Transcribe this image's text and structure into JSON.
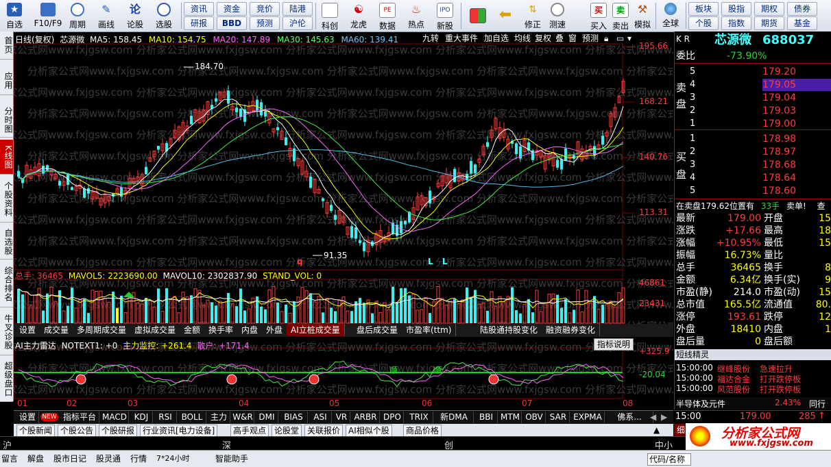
{
  "toolbar": {
    "buttons": [
      {
        "label": "自选",
        "icon": "star-icon"
      },
      {
        "label": "F10/F9",
        "icon": "f10-icon"
      },
      {
        "label": "周期",
        "icon": "clock-icon"
      },
      {
        "label": "画线",
        "icon": "pencil-icon"
      },
      {
        "label": "论股",
        "icon": "discuss-icon"
      },
      {
        "label": "选股",
        "icon": "select-icon"
      }
    ],
    "small_buttons": [
      "资讯",
      "资金",
      "竞价",
      "陆港",
      "研报",
      "BBD",
      "预测",
      "沪伦"
    ],
    "buttons2": [
      {
        "label": "科创",
        "icon": "chart-icon"
      },
      {
        "label": "龙虎",
        "icon": "dragon-icon"
      },
      {
        "label": "数据",
        "icon": "pe-icon"
      },
      {
        "label": "热点",
        "icon": "fire-icon"
      },
      {
        "label": "新股",
        "icon": "ipo-icon"
      }
    ],
    "buttons3": [
      {
        "label": "",
        "icon": "window-icon"
      },
      {
        "label": "",
        "icon": "back-arrow-icon"
      },
      {
        "label": "修正",
        "icon": "updown-icon"
      },
      {
        "label": "测速",
        "icon": "speed-icon"
      },
      {
        "label": "买入",
        "icon": "buy-icon"
      },
      {
        "label": "卖出",
        "icon": "sell-icon"
      },
      {
        "label": "模拟",
        "icon": "hammer-icon"
      },
      {
        "label": "全球",
        "icon": "globe-icon"
      }
    ],
    "right_buttons": [
      "板块",
      "股指",
      "期权",
      "债券",
      "个股",
      "指数",
      "期货",
      "基金"
    ]
  },
  "leftnav": [
    "首页",
    "应用",
    "分时图",
    "K线图",
    "个股资料",
    "自选股",
    "综合排名",
    "牛叉诊股",
    "超级盘口"
  ],
  "chart": {
    "header": {
      "title": "日线(复权)",
      "name": "芯源微",
      "ma5": "MA5: 158.45",
      "ma10": "MA10: 154.75",
      "ma20": "MA20: 147.89",
      "ma30": "MA30: 145.63",
      "ma60": "MA60: 139.41"
    },
    "menu": [
      "九转",
      "重大事件",
      "加自选",
      "均线",
      "复权",
      "叠",
      "窗",
      "预测"
    ],
    "price_axis": [
      "195.66",
      "168.21",
      "140.76",
      "113.31"
    ],
    "high_label": "184.70",
    "low_label": "91.35",
    "markers": [
      "q",
      "L",
      "L"
    ],
    "vol_header": {
      "total": "总手: 36465",
      "mavol5": "MAVOL5: 2223690.00",
      "mavol10": "MAVOL10: 2302837.90",
      "stand": "STAND_VOL: 0"
    },
    "vol_axis": [
      "46861",
      "23431"
    ],
    "tabs": [
      "设置",
      "成交量",
      "多周期成交量",
      "虚拟成交量",
      "金额",
      "换手率",
      "内盘",
      "外盘",
      "AI立桩成交量",
      "盘后成交量",
      "市盈率(ttm)",
      "陆股通持股变化",
      "融资融券变化"
    ],
    "selected_tab": "AI立桩成交量",
    "ind_header": {
      "name": "AI主力雷达",
      "notext": "NOTEXT1: +0",
      "main": "主力监控: +261.4",
      "retail": "散户: +171.4"
    },
    "ind_button": "指标说明",
    "ind_axis": [
      "+325.9",
      "-20.04"
    ],
    "ind_labels": [
      "顺",
      "顺"
    ],
    "months": [
      "01",
      "02",
      "03",
      "04",
      "05",
      "06",
      "07",
      "08"
    ]
  },
  "indicators": [
    "设置",
    "NEW",
    "指标平台",
    "MACD",
    "KDJ",
    "RSI",
    "BOLL",
    "主力",
    "W&R",
    "DMI",
    "BIAS",
    "ASI",
    "VR",
    "ARBR",
    "DPO",
    "TRIX",
    "新DMA",
    "BBI",
    "MTM",
    "OBV",
    "SAR",
    "EXPMA",
    "佛系..."
  ],
  "news_tabs": [
    "个股新闻",
    "个股公告",
    "个股研报",
    "行业资讯[电力设备]",
    "高手观点",
    "论股堂",
    "关联报价",
    "AI相似个股",
    "商品价格"
  ],
  "index_bar": [
    "沪",
    "深",
    "创",
    "中小"
  ],
  "status": [
    "留言",
    "解盘",
    "股市日记",
    "股灵通",
    "行情",
    "7*24小时",
    "智能助手"
  ],
  "status_right": "代码/名称",
  "watermark_url": "www.fxjgsw.com",
  "watermark_cn": "分析家公式网",
  "right": {
    "kr": "K R",
    "stock_name": "芯源微",
    "stock_code": "688037",
    "weibi_label": "委比",
    "weibi": "-73.90%",
    "sell_label": "卖盘",
    "buy_label": "买盘",
    "asks": [
      {
        "n": "5",
        "p": "179.20"
      },
      {
        "n": "4",
        "p": "179.05"
      },
      {
        "n": "3",
        "p": "179.04"
      },
      {
        "n": "2",
        "p": "179.03"
      },
      {
        "n": "1",
        "p": "179.00"
      }
    ],
    "bids": [
      {
        "n": "1",
        "p": "178.98"
      },
      {
        "n": "2",
        "p": "178.97"
      },
      {
        "n": "3",
        "p": "178.68"
      },
      {
        "n": "4",
        "p": "178.64"
      },
      {
        "n": "5",
        "p": "178.60"
      }
    ],
    "notice": "在卖盘179.62位置有",
    "notice_qty": "33手",
    "notice_tail": "卖单!",
    "notice_more": "查",
    "stats": [
      {
        "l": "最新",
        "v": "179.00",
        "l2": "开盘",
        "v2": "15"
      },
      {
        "l": "涨跌",
        "v": "+17.66",
        "l2": "最高",
        "v2": "18"
      },
      {
        "l": "涨幅",
        "v": "+10.95%",
        "l2": "最低",
        "v2": "15"
      },
      {
        "l": "振幅",
        "v": "16.73%",
        "l2": "量比",
        "v2": ""
      },
      {
        "l": "总手",
        "v": "36465",
        "l2": "换手",
        "v2": "8"
      },
      {
        "l": "金额",
        "v": "6.34亿",
        "l2": "换手(实)",
        "v2": "9"
      },
      {
        "l": "市盈(静)",
        "v": "214.0",
        "l2": "市盈(动)",
        "v2": "15"
      },
      {
        "l": "总市值",
        "v": "165.5亿",
        "l2": "流通值",
        "v2": "80."
      },
      {
        "l": "涨停",
        "v": "193.61",
        "l2": "跌停",
        "v2": "12"
      },
      {
        "l": "外盘",
        "v": "18410",
        "l2": "内盘",
        "v2": "1"
      },
      {
        "l": "盘后量",
        "v": "0",
        "l2": "盘后额",
        "v2": ""
      }
    ],
    "sprite_title": "短线精灵",
    "sprites": [
      {
        "t": "15:00:00",
        "s": "继峰股份",
        "e": "急速拉升"
      },
      {
        "t": "15:00:00",
        "s": "福达合金",
        "e": "打开跌停板"
      },
      {
        "t": "15:00:00",
        "s": "风范股份",
        "e": "打开跌停板"
      }
    ],
    "sector": "半导体及元件",
    "sector_pct": "2.43%",
    "sector_tail": "同行业",
    "last_time": "15:00",
    "last_price": "179.00",
    "last_vol": "285",
    "bottom_tab": "细"
  }
}
